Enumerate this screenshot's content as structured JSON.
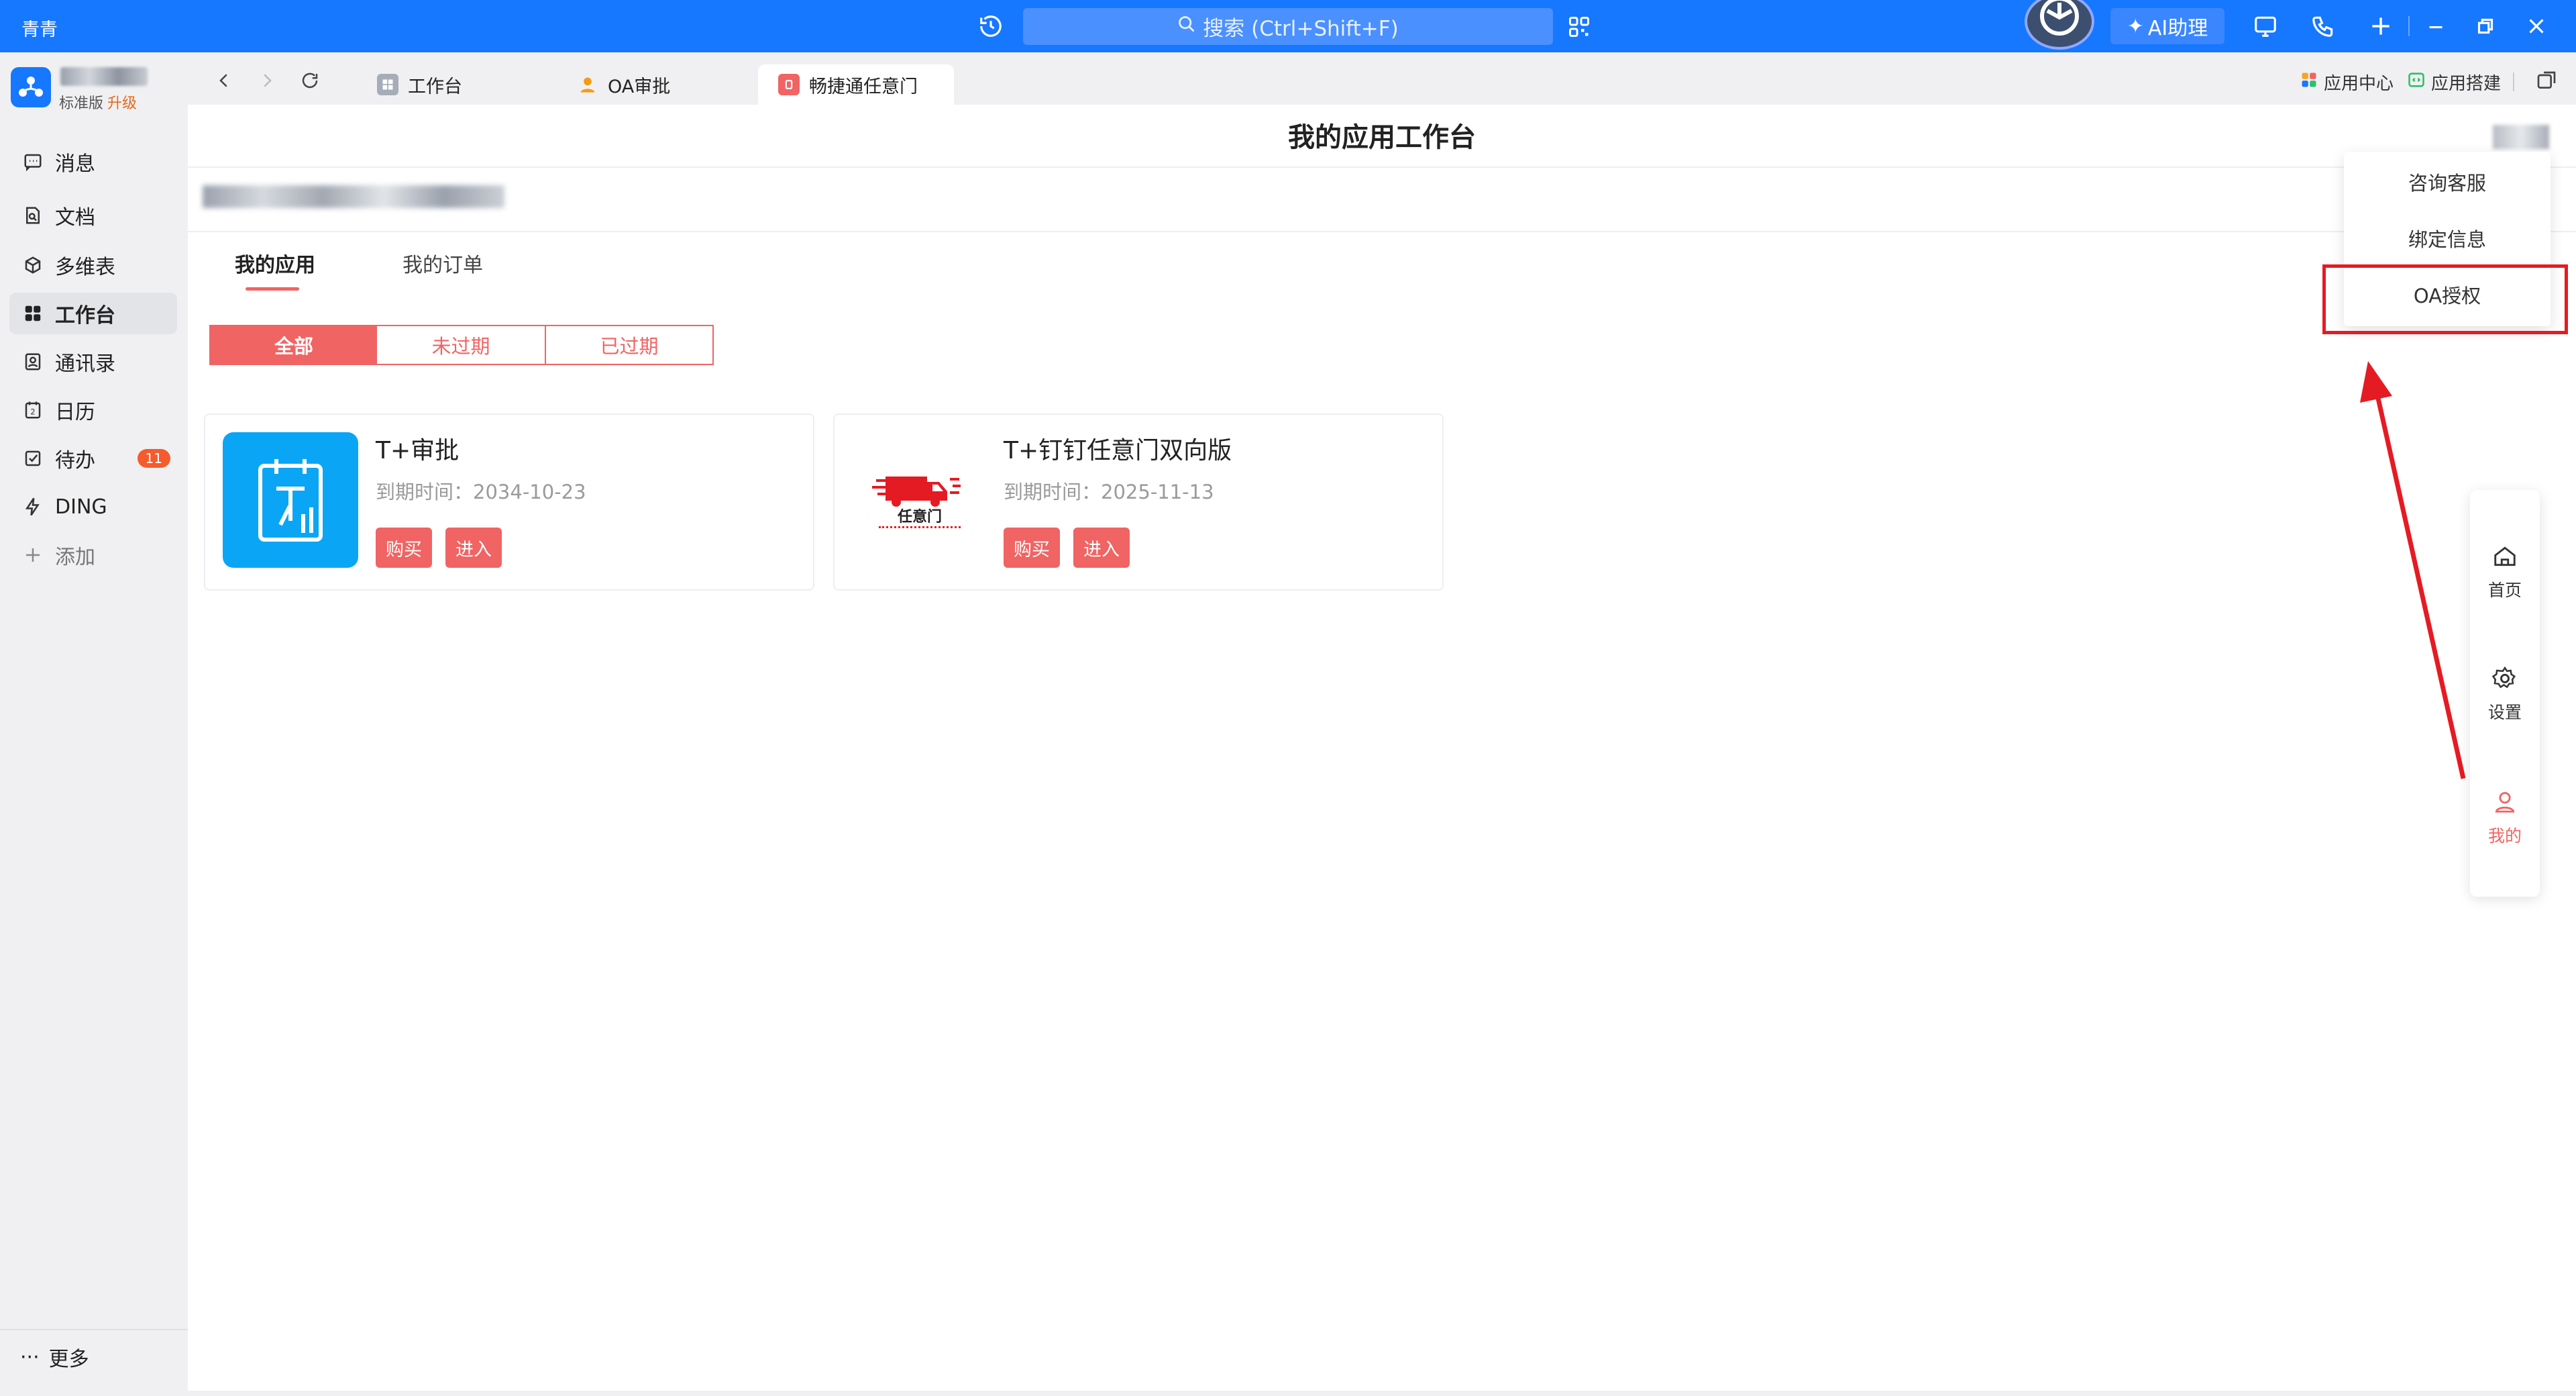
{
  "titlebar": {
    "app_name": "青青",
    "search_placeholder": "搜索 (Ctrl+Shift+F)",
    "ai_label": "AI助理"
  },
  "sidebar": {
    "org_badge": "标准版",
    "org_upgrade": "升级",
    "items": [
      {
        "label": "消息",
        "icon": "message-icon"
      },
      {
        "label": "文档",
        "icon": "doc-icon"
      },
      {
        "label": "多维表",
        "icon": "cube-icon"
      },
      {
        "label": "工作台",
        "icon": "grid-icon",
        "active": true
      },
      {
        "label": "通讯录",
        "icon": "contact-icon"
      },
      {
        "label": "日历",
        "icon": "calendar-icon"
      },
      {
        "label": "待办",
        "icon": "todo-icon",
        "badge": "11"
      },
      {
        "label": "DING",
        "icon": "lightning-icon"
      },
      {
        "label": "添加",
        "icon": "plus-icon"
      }
    ],
    "more_label": "更多"
  },
  "tabs": [
    {
      "label": "工作台"
    },
    {
      "label": "OA审批"
    },
    {
      "label": "畅捷通任意门",
      "active": true
    }
  ],
  "tab_links": {
    "app_center": "应用中心",
    "app_build": "应用搭建"
  },
  "page": {
    "title": "我的应用工作台",
    "content_tabs": [
      "我的应用",
      "我的订单"
    ],
    "filters": [
      "全部",
      "未过期",
      "已过期"
    ]
  },
  "cards": [
    {
      "title": "T+审批",
      "expiry_label": "到期时间：",
      "expiry": "2034-10-23",
      "buy": "购买",
      "enter": "进入"
    },
    {
      "title": "T+钉钉任意门双向版",
      "expiry_label": "到期时间：",
      "expiry": "2025-11-13",
      "buy": "购买",
      "enter": "进入",
      "logo_text": "任意门"
    }
  ],
  "dropdown": {
    "items": [
      "咨询客服",
      "绑定信息",
      "OA授权"
    ]
  },
  "float_panel": {
    "items": [
      {
        "label": "首页",
        "icon": "home-icon"
      },
      {
        "label": "设置",
        "icon": "gear-icon"
      },
      {
        "label": "我的",
        "icon": "user-icon",
        "active": true
      }
    ]
  },
  "colors": {
    "brand_blue": "#1677ff",
    "accent_red": "#f06464",
    "annotation_red": "#e51b23"
  }
}
